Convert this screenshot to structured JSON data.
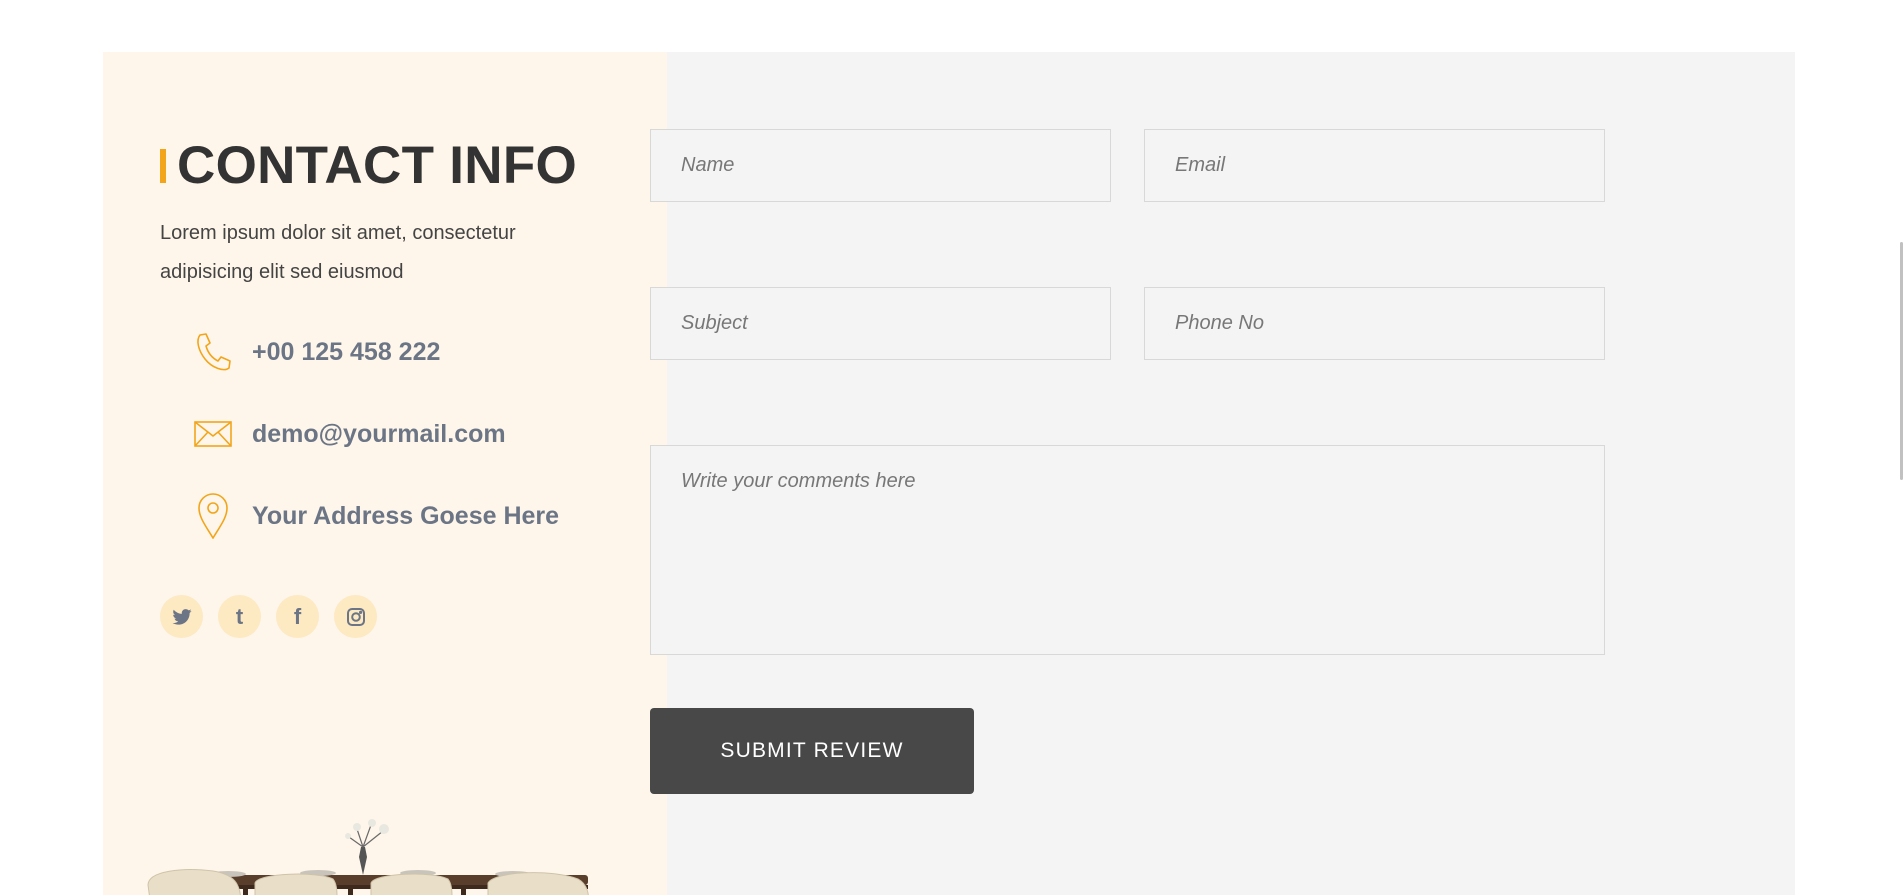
{
  "contact": {
    "title": "CONTACT INFO",
    "description": "Lorem ipsum dolor sit amet, consectetur adipisicing elit sed eiusmod",
    "phone": "+00 125 458 222",
    "email": "demo@yourmail.com",
    "address": "Your Address Goese Here",
    "socials": [
      {
        "icon": "twitter-icon",
        "glyph": "🐦"
      },
      {
        "icon": "tumblr-icon",
        "glyph": "t"
      },
      {
        "icon": "facebook-icon",
        "glyph": "f"
      },
      {
        "icon": "instagram-icon",
        "glyph": "◎"
      }
    ]
  },
  "form": {
    "name_placeholder": "Name",
    "email_placeholder": "Email",
    "subject_placeholder": "Subject",
    "phone_placeholder": "Phone No",
    "comment_placeholder": "Write your comments here",
    "submit_label": "SUBMIT REVIEW"
  },
  "colors": {
    "accent": "#f2a51a",
    "left_bg": "#fef6ea",
    "right_bg": "#f4f4f4",
    "button_bg": "#484848",
    "social_bg": "#fde9c2",
    "info_text": "#6b7585"
  }
}
